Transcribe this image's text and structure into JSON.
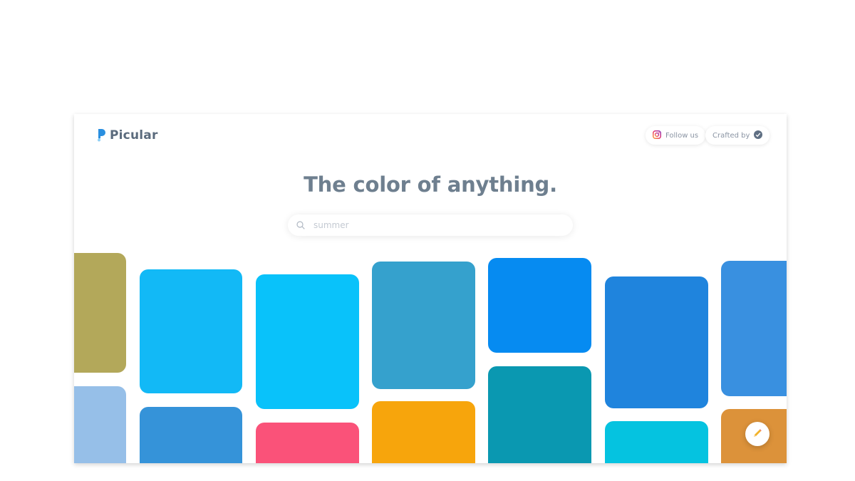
{
  "app": {
    "name": "Picular"
  },
  "header": {
    "follow_label": "Follow us",
    "crafted_label": "Crafted by"
  },
  "hero": {
    "title": "The color of anything."
  },
  "search": {
    "placeholder": "summer",
    "value": ""
  },
  "tiles": [
    {
      "color": "#b3a85a"
    },
    {
      "color": "#96bfe8"
    },
    {
      "color": "#12b9f6"
    },
    {
      "color": "#3593d9"
    },
    {
      "color": "#09c2fa"
    },
    {
      "color": "#fa5279"
    },
    {
      "color": "#35a1cd"
    },
    {
      "color": "#f7a50c"
    },
    {
      "color": "#068bf1"
    },
    {
      "color": "#0a98b1"
    },
    {
      "color": "#1f84dd"
    },
    {
      "color": "#05c3e0"
    },
    {
      "color": "#3990e0"
    },
    {
      "color": "#dc923a"
    }
  ],
  "icons": {
    "logo": "picular-drop-icon",
    "instagram": "instagram-icon",
    "crafted": "badge-check-icon",
    "search": "search-icon",
    "fab": "pencil-icon"
  }
}
